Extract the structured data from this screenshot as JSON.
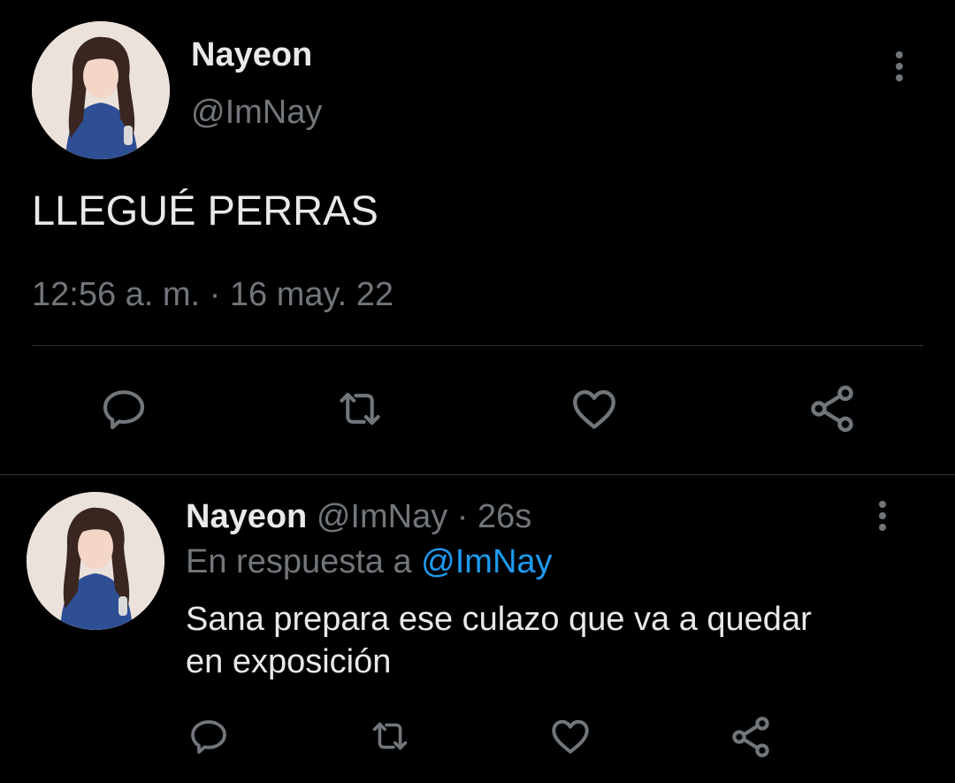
{
  "main_tweet": {
    "display_name": "Nayeon",
    "handle": "@ImNay",
    "text": "LLEGUÉ PERRAS",
    "timestamp": "12:56 a. m. · 16 may. 22",
    "actions": [
      "reply-icon",
      "retweet-icon",
      "like-icon",
      "share-icon"
    ]
  },
  "reply_tweet": {
    "display_name": "Nayeon",
    "handle": "@ImNay",
    "separator": "·",
    "age": "26s",
    "replying_prefix": "En respuesta a",
    "replying_to": "@ImNay",
    "text_line1": "Sana prepara ese culazo que va a quedar",
    "text_line2": "en exposición",
    "actions": [
      "reply-icon",
      "retweet-icon",
      "like-icon",
      "share-icon"
    ]
  },
  "colors": {
    "background": "#000000",
    "text": "#e7e9ea",
    "muted": "#71767b",
    "link": "#1d9bf0",
    "divider": "#2f3336"
  }
}
